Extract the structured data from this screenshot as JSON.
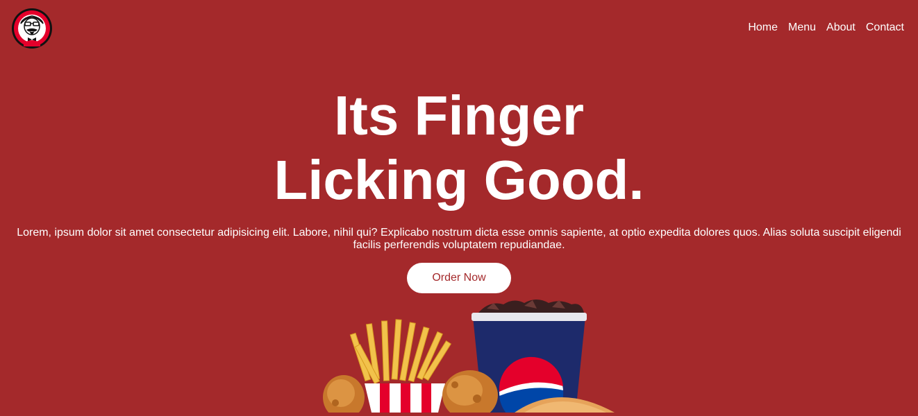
{
  "nav": {
    "items": [
      {
        "label": "Home"
      },
      {
        "label": "Menu"
      },
      {
        "label": "About"
      },
      {
        "label": "Contact"
      }
    ]
  },
  "hero": {
    "headline_line1": "Its Finger",
    "headline_line2": "Licking Good.",
    "description": "Lorem, ipsum dolor sit amet consectetur adipisicing elit. Labore, nihil qui? Explicabo nostrum dicta esse omnis sapiente, at optio expedita dolores quos. Alias soluta suscipit eligendi facilis perferendis voluptatem repudiandae.",
    "cta_label": "Order Now"
  },
  "icons": {
    "logo": "colonel-logo-icon",
    "meal": "meal-combo-image"
  },
  "colors": {
    "background": "#a4292b",
    "text": "#ffffff",
    "button_bg": "#ffffff",
    "button_text": "#a4292b"
  }
}
